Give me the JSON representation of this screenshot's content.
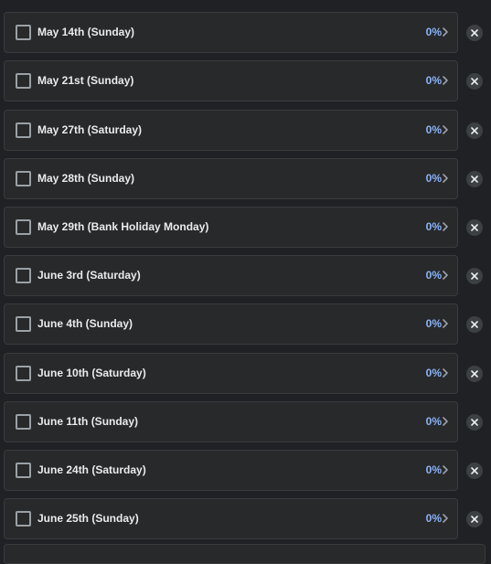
{
  "items": [
    {
      "label": "May 14th (Sunday)",
      "progress": "0%"
    },
    {
      "label": "May 21st (Sunday)",
      "progress": "0%"
    },
    {
      "label": "May 27th (Saturday)",
      "progress": "0%"
    },
    {
      "label": "May 28th (Sunday)",
      "progress": "0%"
    },
    {
      "label": "May 29th (Bank Holiday Monday)",
      "progress": "0%"
    },
    {
      "label": "June 3rd (Saturday)",
      "progress": "0%"
    },
    {
      "label": "June 4th (Sunday)",
      "progress": "0%"
    },
    {
      "label": "June 10th (Saturday)",
      "progress": "0%"
    },
    {
      "label": "June 11th (Sunday)",
      "progress": "0%"
    },
    {
      "label": "June 24th (Saturday)",
      "progress": "0%"
    },
    {
      "label": "June 25th (Sunday)",
      "progress": "0%"
    }
  ],
  "icons": {
    "checkbox": "checkbox-icon",
    "chevron": "chevron-right-icon",
    "remove": "close-icon"
  },
  "colors": {
    "background": "#202124",
    "card": "#28292a",
    "text": "#e8eaed",
    "accent": "#8ab4f8"
  }
}
